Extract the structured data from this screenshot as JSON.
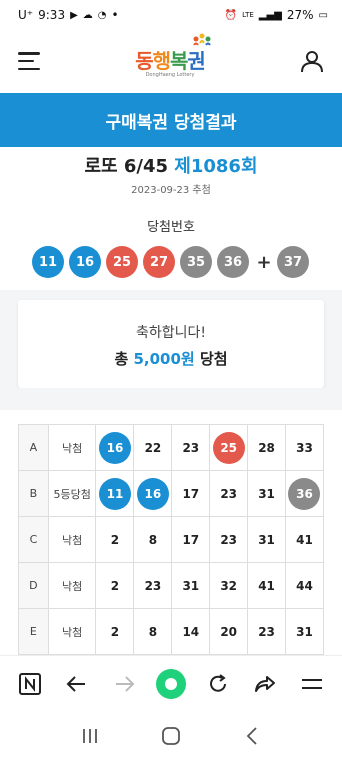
{
  "statusbar": {
    "carrier": "U⁺",
    "time": "9:33",
    "dot": "•",
    "network": "LTE",
    "battery": "27%"
  },
  "header": {
    "logo_main": [
      "동",
      "행",
      "복",
      "권"
    ],
    "logo_sub": "DongHaeng Lottery"
  },
  "banner": {
    "title": "구매복권 당첨결과"
  },
  "draw": {
    "game": "로또 6/45",
    "round": "제1086회",
    "date": "2023-09-23 추첨"
  },
  "winning": {
    "label": "당첨번호",
    "numbers": [
      {
        "n": "11",
        "color": "#1a8fd3"
      },
      {
        "n": "16",
        "color": "#1a8fd3"
      },
      {
        "n": "25",
        "color": "#e35a4c"
      },
      {
        "n": "27",
        "color": "#e35a4c"
      },
      {
        "n": "35",
        "color": "#8a8a8a"
      },
      {
        "n": "36",
        "color": "#8a8a8a"
      }
    ],
    "plus": "+",
    "bonus": {
      "n": "37",
      "color": "#8a8a8a"
    }
  },
  "result": {
    "congrats": "축하합니다!",
    "prefix": "총 ",
    "amount": "5,000원",
    "suffix": " 당첨"
  },
  "ticket": [
    {
      "row": "A",
      "rank": "낙첨",
      "nums": [
        {
          "n": "16",
          "ball": "#1a8fd3"
        },
        {
          "n": "22"
        },
        {
          "n": "23"
        },
        {
          "n": "25",
          "ball": "#e35a4c"
        },
        {
          "n": "28"
        },
        {
          "n": "33"
        }
      ]
    },
    {
      "row": "B",
      "rank": "5등당첨",
      "nums": [
        {
          "n": "11",
          "ball": "#1a8fd3"
        },
        {
          "n": "16",
          "ball": "#1a8fd3"
        },
        {
          "n": "17"
        },
        {
          "n": "23"
        },
        {
          "n": "31"
        },
        {
          "n": "36",
          "ball": "#8a8a8a"
        }
      ]
    },
    {
      "row": "C",
      "rank": "낙첨",
      "nums": [
        {
          "n": "2"
        },
        {
          "n": "8"
        },
        {
          "n": "17"
        },
        {
          "n": "23"
        },
        {
          "n": "31"
        },
        {
          "n": "41"
        }
      ]
    },
    {
      "row": "D",
      "rank": "낙첨",
      "nums": [
        {
          "n": "2"
        },
        {
          "n": "23"
        },
        {
          "n": "31"
        },
        {
          "n": "32"
        },
        {
          "n": "41"
        },
        {
          "n": "44"
        }
      ]
    },
    {
      "row": "E",
      "rank": "낙첨",
      "nums": [
        {
          "n": "2"
        },
        {
          "n": "8"
        },
        {
          "n": "14"
        },
        {
          "n": "20"
        },
        {
          "n": "23"
        },
        {
          "n": "31"
        }
      ]
    }
  ],
  "colors": {
    "accent": "#1a8fd3",
    "red_ball": "#e35a4c",
    "gray_ball": "#8a8a8a",
    "home_green": "#1fd17a"
  }
}
